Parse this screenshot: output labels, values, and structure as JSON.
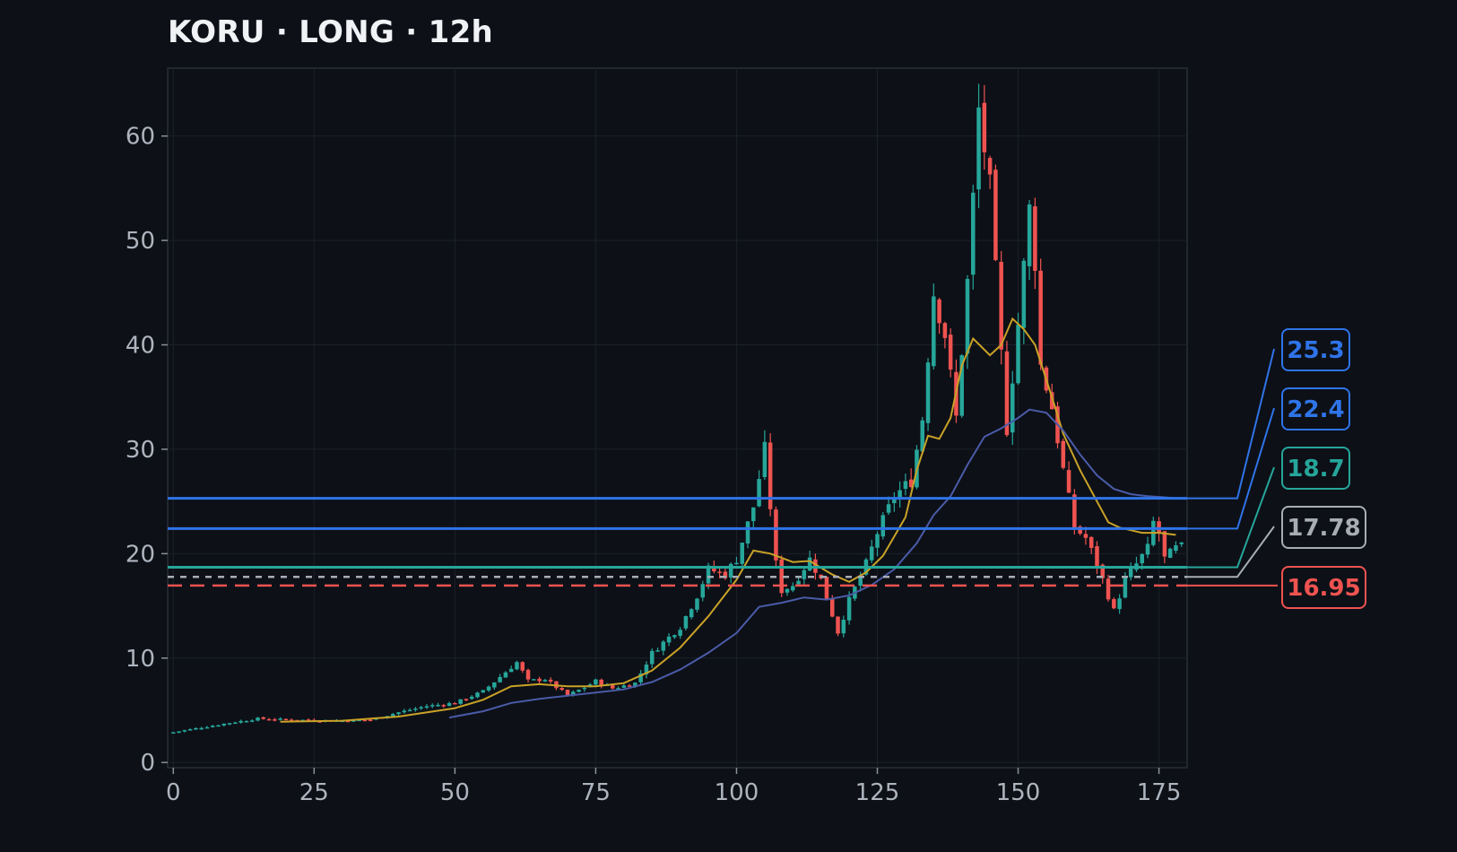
{
  "title": "KORU · LONG · 12h",
  "chart_data": {
    "type": "candlestick",
    "title": "KORU · LONG · 12h",
    "xlabel": "",
    "ylabel": "",
    "xlim": [
      -1,
      180
    ],
    "ylim": [
      -0.5,
      66.5
    ],
    "x_ticks": [
      0,
      25,
      50,
      75,
      100,
      125,
      150,
      175
    ],
    "y_ticks": [
      0,
      10,
      20,
      30,
      40,
      50,
      60
    ],
    "grid": true,
    "colors": {
      "up": "#26a69a",
      "down": "#ef5350",
      "ma_fast": "#c9a227",
      "ma_slow": "#4a5ba8",
      "blue": "#2f74e8",
      "teal": "#26a69a",
      "gray": "#a8adb5",
      "red": "#ef5350",
      "background": "#0d1017"
    },
    "close_points": [
      [
        0,
        2.9
      ],
      [
        10,
        3.8
      ],
      [
        15,
        4.2
      ],
      [
        20,
        4.1
      ],
      [
        30,
        4.0
      ],
      [
        35,
        4.1
      ],
      [
        40,
        4.8
      ],
      [
        45,
        5.4
      ],
      [
        50,
        5.7
      ],
      [
        55,
        6.8
      ],
      [
        58,
        8.2
      ],
      [
        61,
        9.6
      ],
      [
        63,
        7.8
      ],
      [
        66,
        8.0
      ],
      [
        70,
        6.4
      ],
      [
        73,
        7.2
      ],
      [
        75,
        7.8
      ],
      [
        78,
        7.1
      ],
      [
        82,
        7.6
      ],
      [
        85,
        10.5
      ],
      [
        90,
        13.0
      ],
      [
        93,
        16.0
      ],
      [
        95,
        18.5
      ],
      [
        98,
        18.0
      ],
      [
        100,
        19.5
      ],
      [
        103,
        24.5
      ],
      [
        105,
        30.0
      ],
      [
        107,
        19.0
      ],
      [
        108,
        16.5
      ],
      [
        110,
        17.0
      ],
      [
        113,
        19.5
      ],
      [
        115,
        17.5
      ],
      [
        118,
        12.5
      ],
      [
        120,
        15.5
      ],
      [
        123,
        19.0
      ],
      [
        125,
        22.0
      ],
      [
        128,
        25.5
      ],
      [
        131,
        27.0
      ],
      [
        133,
        33.0
      ],
      [
        135,
        45.0
      ],
      [
        137,
        41.0
      ],
      [
        139,
        33.0
      ],
      [
        141,
        46.0
      ],
      [
        142,
        54.0
      ],
      [
        143,
        62.5
      ],
      [
        145,
        55.0
      ],
      [
        147,
        39.0
      ],
      [
        148,
        32.0
      ],
      [
        150,
        42.0
      ],
      [
        152,
        53.0
      ],
      [
        153,
        48.0
      ],
      [
        154,
        38.0
      ],
      [
        156,
        34.0
      ],
      [
        158,
        28.0
      ],
      [
        160,
        22.5
      ],
      [
        162,
        21.5
      ],
      [
        164,
        19.0
      ],
      [
        166,
        16.0
      ],
      [
        167,
        14.5
      ],
      [
        169,
        17.5
      ],
      [
        171,
        19.0
      ],
      [
        173,
        20.5
      ],
      [
        174,
        23.0
      ],
      [
        175,
        22.0
      ],
      [
        176,
        19.5
      ],
      [
        178,
        20.5
      ],
      [
        179,
        20.6
      ]
    ],
    "ma_fast": [
      [
        19,
        3.9
      ],
      [
        30,
        4.0
      ],
      [
        40,
        4.4
      ],
      [
        50,
        5.2
      ],
      [
        55,
        6.0
      ],
      [
        60,
        7.3
      ],
      [
        65,
        7.5
      ],
      [
        70,
        7.3
      ],
      [
        75,
        7.3
      ],
      [
        80,
        7.6
      ],
      [
        85,
        8.8
      ],
      [
        90,
        11.0
      ],
      [
        95,
        14.0
      ],
      [
        100,
        17.5
      ],
      [
        103,
        20.3
      ],
      [
        106,
        20.0
      ],
      [
        110,
        19.2
      ],
      [
        113,
        19.3
      ],
      [
        117,
        18.0
      ],
      [
        120,
        17.3
      ],
      [
        123,
        18.2
      ],
      [
        126,
        19.8
      ],
      [
        130,
        23.5
      ],
      [
        132,
        28.0
      ],
      [
        134,
        31.3
      ],
      [
        136,
        31.0
      ],
      [
        138,
        33.0
      ],
      [
        140,
        38.0
      ],
      [
        142,
        40.6
      ],
      [
        145,
        39.0
      ],
      [
        147,
        40.0
      ],
      [
        149,
        42.5
      ],
      [
        151,
        41.5
      ],
      [
        153,
        40.0
      ],
      [
        156,
        35.0
      ],
      [
        158,
        31.5
      ],
      [
        161,
        28.0
      ],
      [
        164,
        25.0
      ],
      [
        166,
        23.0
      ],
      [
        168,
        22.5
      ],
      [
        172,
        22.0
      ],
      [
        175,
        22.0
      ],
      [
        178,
        21.8
      ]
    ],
    "ma_slow": [
      [
        49,
        4.3
      ],
      [
        55,
        4.9
      ],
      [
        60,
        5.7
      ],
      [
        65,
        6.1
      ],
      [
        70,
        6.4
      ],
      [
        75,
        6.7
      ],
      [
        80,
        7.0
      ],
      [
        85,
        7.7
      ],
      [
        90,
        8.9
      ],
      [
        95,
        10.5
      ],
      [
        100,
        12.4
      ],
      [
        104,
        14.9
      ],
      [
        108,
        15.3
      ],
      [
        112,
        15.8
      ],
      [
        116,
        15.6
      ],
      [
        120,
        16.0
      ],
      [
        124,
        17.0
      ],
      [
        128,
        18.5
      ],
      [
        132,
        21.0
      ],
      [
        135,
        23.7
      ],
      [
        138,
        25.5
      ],
      [
        141,
        28.5
      ],
      [
        144,
        31.2
      ],
      [
        147,
        32.0
      ],
      [
        150,
        33.0
      ],
      [
        152,
        33.8
      ],
      [
        155,
        33.5
      ],
      [
        158,
        31.8
      ],
      [
        161,
        29.5
      ],
      [
        164,
        27.5
      ],
      [
        167,
        26.2
      ],
      [
        170,
        25.7
      ],
      [
        173,
        25.5
      ],
      [
        176,
        25.4
      ],
      [
        178,
        25.3
      ]
    ],
    "levels": [
      {
        "value": 25.3,
        "label": "25.3",
        "color": "#2f74e8",
        "style": "solid"
      },
      {
        "value": 22.4,
        "label": "22.4",
        "color": "#2f74e8",
        "style": "solid"
      },
      {
        "value": 18.7,
        "label": "18.7",
        "color": "#26a69a",
        "style": "solid"
      },
      {
        "value": 17.78,
        "label": "17.78",
        "color": "#a8adb5",
        "style": "dotted"
      },
      {
        "value": 16.95,
        "label": "16.95",
        "color": "#ef5350",
        "style": "dashed"
      }
    ]
  }
}
